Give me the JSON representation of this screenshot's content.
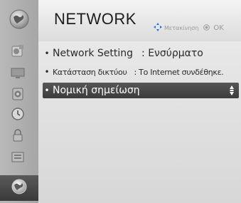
{
  "header": {
    "title": "NETWORK",
    "hint": {
      "move_label": "Μετακίνηση",
      "ok_label": "OK"
    }
  },
  "sidebar": {
    "icons": [
      "globe-icon",
      "photo-icon",
      "monitor-icon",
      "speaker-icon",
      "clock-icon",
      "lock-icon",
      "settings-box-icon",
      "network-globe-icon"
    ]
  },
  "menu": {
    "items": [
      {
        "label": "Network Setting",
        "value": ": Ενσύρματο",
        "selected": false
      },
      {
        "label": "Κατάσταση δικτύου",
        "value": ": Το Internet συνδέθηκε.",
        "selected": false
      },
      {
        "label": "Νομική σημείωση",
        "value": "",
        "selected": true
      }
    ]
  },
  "colors": {
    "selected_bg": "#484848",
    "sidebar_bg": "#b0b0b0",
    "accent_blue": "#2a6fd6"
  }
}
